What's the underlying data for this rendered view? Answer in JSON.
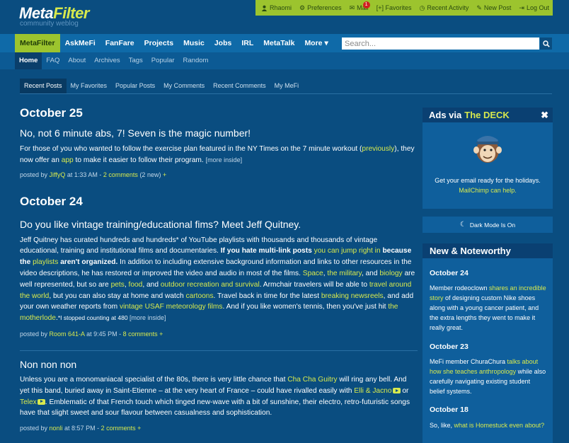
{
  "header": {
    "logo_meta": "Meta",
    "logo_filter": "Filter",
    "logo_sub": "community weblog"
  },
  "userbar": {
    "user": "Rhaomi",
    "preferences": "Preferences",
    "mail": "Mail",
    "mail_badge": "1",
    "favorites": "[+] Favorites",
    "recent_activity": "Recent Activity",
    "new_post": "New Post",
    "logout": "Log Out"
  },
  "nav": {
    "items": [
      "MetaFilter",
      "AskMeFi",
      "FanFare",
      "Projects",
      "Music",
      "Jobs",
      "IRL",
      "MetaTalk",
      "More ▾"
    ],
    "search_placeholder": "Search..."
  },
  "subnav": {
    "items": [
      "Home",
      "FAQ",
      "About",
      "Archives",
      "Tags",
      "Popular",
      "Random"
    ]
  },
  "tabs": [
    "Recent Posts",
    "My Favorites",
    "Popular Posts",
    "My Comments",
    "Recent Comments",
    "My MeFi"
  ],
  "posts": {
    "date1": "October 25",
    "p1": {
      "title": "No, not 6 minute abs, 7! Seven is the magic number!",
      "t1": "For those of you who wanted to follow the exercise plan featured in the NY Times on the 7 minute workout (",
      "l1": "previously",
      "t2": "), they now offer an ",
      "l2": "app",
      "t3": " to make it easier to follow their program. ",
      "more": "[more inside]",
      "meta_a": "posted by ",
      "author": "JiffyQ",
      "meta_b": " at 1:33 AM - ",
      "comments": "2 comments",
      "meta_c": " (2 new) ",
      "plus": "+"
    },
    "date2": "October 24",
    "p2": {
      "title": "Do you like vintage training/educational fims? Meet Jeff Quitney.",
      "t1": "Jeff Quitney has curated hundreds and hundreds* of YouTube playlists with thousands and thousands of vintage educational, training and institutional films and documentaries. ",
      "b1": "If you hate multi-link posts ",
      "l1": "you can jump right in",
      "b2": " because the ",
      "l2": "playlists",
      "b3": " aren't organized.",
      "t2": " In addition to including extensive background information and links to other resources in the video descriptions, he has restored or improved the video and audio in most of the films. ",
      "l3": "Space",
      "t3": ", ",
      "l4": "the military",
      "t4": ", and ",
      "l5": "biology",
      "t5": " are well represented, but so are ",
      "l6": "pets",
      "t6": ", ",
      "l7": "food",
      "t7": ", and ",
      "l8": "outdoor recreation and survival",
      "t8": ". Armchair travelers will be able to ",
      "l9": "travel around the world",
      "t9": ", but you can also stay at home and watch ",
      "l10": "cartoons",
      "t10": ". Travel back in time for the latest ",
      "l11": "breaking newsreels",
      "t11": ", and add your own weather reports from ",
      "l12": "vintage USAF meteorology films",
      "t12": ". And if you like women's tennis, then you've just hit ",
      "l13": "the motherlode",
      "t13": ".",
      "foot": "*I stopped counting at 480 ",
      "more": "[more inside]",
      "meta_a": "posted by ",
      "author": "Room 641-A",
      "meta_b": " at 9:45 PM - ",
      "comments": "8 comments",
      "plus": " +"
    },
    "p3": {
      "title": "Non non non",
      "t1": "Unless you are a monomaniacal specialist of the 80s, there is very little chance that ",
      "l1": "Cha Cha Guitry",
      "t2": " will ring any bell. And yet this band, buried away in Saint-Etienne – at the very heart of France – could have rivalled easily with ",
      "l2": "Elli & Jacno",
      "t3": " or ",
      "l3": "Telex",
      "t4": ". Emblematic of that French touch which tinged new-wave with a bit of sunshine, their electro, retro-futuristic songs have that slight sweet and sour flavour between casualness and sophistication.",
      "meta_a": "posted by ",
      "author": "nonli",
      "meta_b": " at 8:57 PM - ",
      "comments": "2 comments",
      "plus": " +"
    }
  },
  "sidebar": {
    "ads_label": "Ads via",
    "ads_deck": "The DECK",
    "close": "✖",
    "ad_line1": "Get your email ready for the holidays.",
    "ad_link": "MailChimp can help.",
    "dark_mode": "Dark Mode Is On",
    "news_title": "New & Noteworthy",
    "n1_date": "October 24",
    "n1_a": "Member rodeoclown ",
    "n1_link": "shares an incredible story",
    "n1_b": " of designing custom Nike shoes along with a young cancer patient, and the extra lengths they went to make it really great.",
    "n2_date": "October 23",
    "n2_a": "MeFi member ChuraChura ",
    "n2_link": "talks about how she teaches anthropology",
    "n2_b": " while also carefully navigating existing student belief systems.",
    "n3_date": "October 18",
    "n3_a": "So, like, ",
    "n3_link": "what is Homestuck even about?"
  },
  "colors": {
    "background": "#0a4d80",
    "accent_green": "#9cc42e",
    "link_yellow": "#d7e94d",
    "nav_blue": "#0f6aa8"
  },
  "icons": [
    "user-icon",
    "gear-icon",
    "mail-icon",
    "clock-icon",
    "pencil-icon",
    "logout-icon",
    "search-icon",
    "moon-icon",
    "mailchimp-logo",
    "youtube-icon"
  ]
}
